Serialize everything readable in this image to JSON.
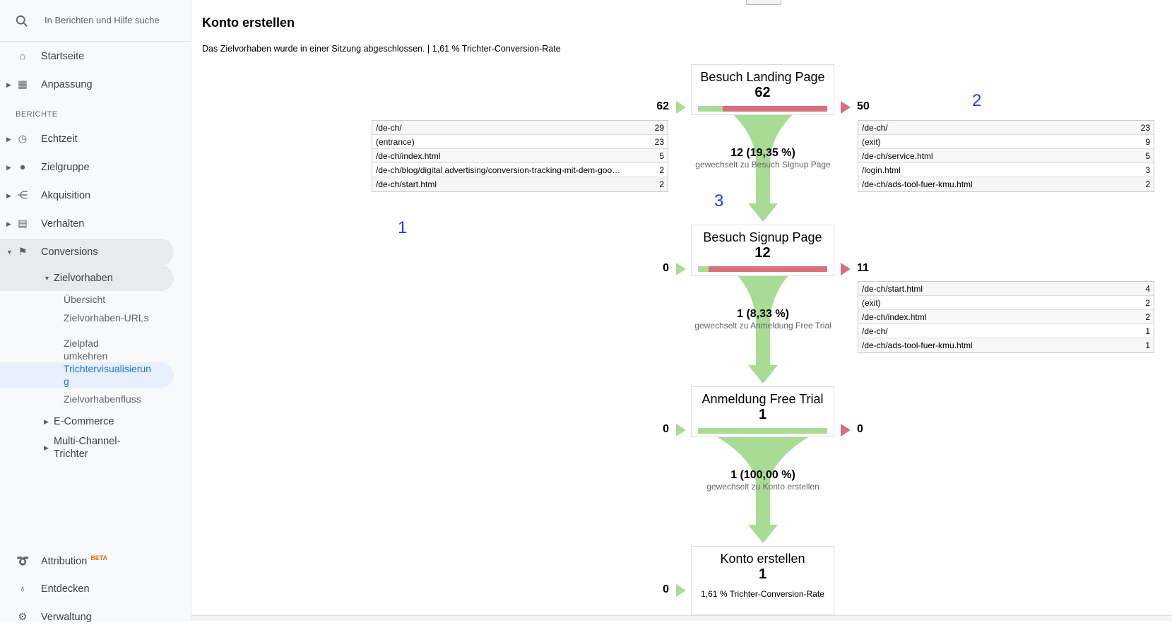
{
  "sidebar": {
    "search_placeholder": "In Berichten und Hilfe suche",
    "home": "Startseite",
    "customization": "Anpassung",
    "section": "BERICHTE",
    "items": [
      "Echtzeit",
      "Zielgruppe",
      "Akquisition",
      "Verhalten",
      "Conversions"
    ],
    "goals": "Zielvorhaben",
    "goal_sub": [
      "Übersicht",
      "Zielvorhaben-URLs",
      "Zielpfad umkehren",
      "Trichtervisualisierung",
      "Zielvorhabenfluss"
    ],
    "ecommerce": "E-Commerce",
    "mcf": "Multi-Channel-Trichter",
    "attribution": "Attribution",
    "beta": "BETA",
    "discover": "Entdecken",
    "admin": "Verwaltung"
  },
  "page": {
    "title": "Konto erstellen",
    "subtitle": "Das Zielvorhaben wurde in einer Sitzung abgeschlossen. | 1,61 % Trichter-Conversion-Rate"
  },
  "colors": {
    "continue": "#a8dc95",
    "exit": "#d4717c",
    "annotation": "#1a3cff",
    "selected": "#1a73e8"
  },
  "steps": [
    {
      "name": "Besuch Landing Page",
      "value": "62",
      "entries": "62",
      "exits": "50",
      "continued_fraction": 0.1935,
      "conv_value": "12 (19,35 %)",
      "conv_text": "gewechselt zu Besuch Signup Page"
    },
    {
      "name": "Besuch Signup Page",
      "value": "12",
      "entries": "0",
      "exits": "11",
      "continued_fraction": 0.0833,
      "conv_value": "1 (8,33 %)",
      "conv_text": "gewechselt zu Anmeldung Free Trial"
    },
    {
      "name": "Anmeldung Free Trial",
      "value": "1",
      "entries": "0",
      "exits": "0",
      "continued_fraction": 1.0,
      "conv_value": "1 (100,00 %)",
      "conv_text": "gewechselt zu Konto erstellen"
    },
    {
      "name": "Konto erstellen",
      "value": "1",
      "entries": "0",
      "rate": "1,61 % Trichter-Conversion-Rate"
    }
  ],
  "entry_table": [
    [
      "/de-ch/",
      "29"
    ],
    [
      "(entrance)",
      "23"
    ],
    [
      "/de-ch/index.html",
      "5"
    ],
    [
      "/de-ch/blog/digital advertising/conversion-tracking-mit-dem-goo…",
      "2"
    ],
    [
      "/de-ch/start.html",
      "2"
    ]
  ],
  "exit_table_1": [
    [
      "/de-ch/",
      "23"
    ],
    [
      "(exit)",
      "9"
    ],
    [
      "/de-ch/service.html",
      "5"
    ],
    [
      "/login.html",
      "3"
    ],
    [
      "/de-ch/ads-tool-fuer-kmu.html",
      "2"
    ]
  ],
  "exit_table_2": [
    [
      "/de-ch/start.html",
      "4"
    ],
    [
      "(exit)",
      "2"
    ],
    [
      "/de-ch/index.html",
      "2"
    ],
    [
      "/de-ch/",
      "1"
    ],
    [
      "/de-ch/ads-tool-fuer-kmu.html",
      "1"
    ]
  ],
  "annotations": [
    "1",
    "2",
    "3"
  ]
}
